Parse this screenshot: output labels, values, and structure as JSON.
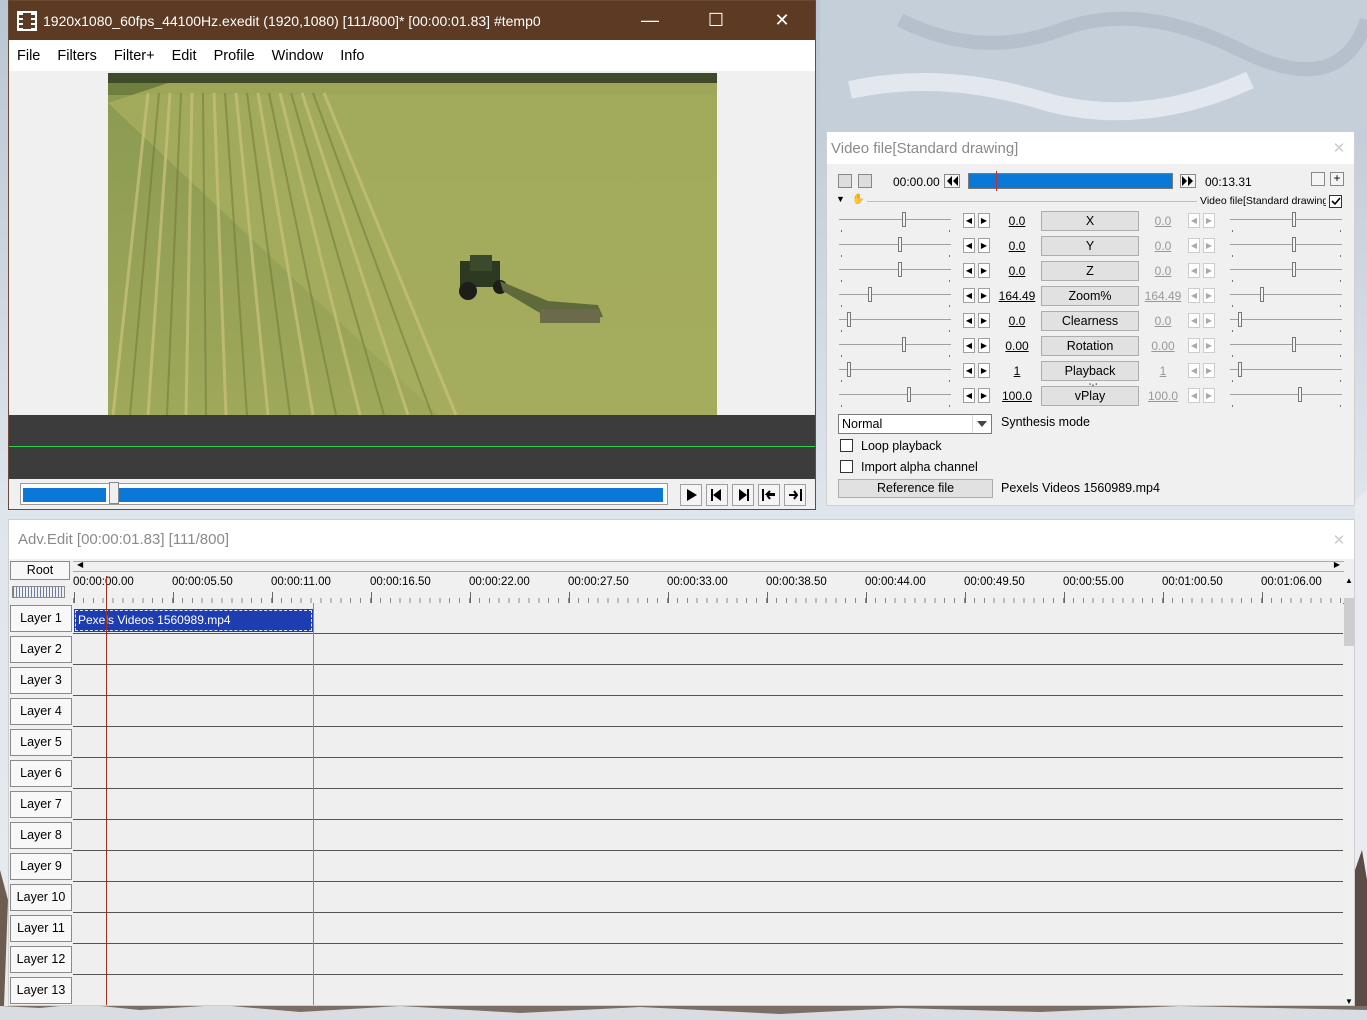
{
  "main_window": {
    "title": "1920x1080_60fps_44100Hz.exedit (1920,1080)  [111/800]* [00:00:01.83]  #temp0",
    "menu": [
      "File",
      "Filters",
      "Filter+",
      "Edit",
      "Profile",
      "Window",
      "Info"
    ],
    "seek_position": 0.14
  },
  "settings_window": {
    "title": "Video file[Standard drawing]",
    "time_start": "00:00.00",
    "time_end": "00:13.31",
    "section_label": "Video file[Standard drawing]",
    "section_enabled": true,
    "params": [
      {
        "left": "0.0",
        "label": "X",
        "right": "0.0"
      },
      {
        "left": "0.0",
        "label": "Y",
        "right": "0.0"
      },
      {
        "left": "0.0",
        "label": "Z",
        "right": "0.0"
      },
      {
        "left": "164.49",
        "label": "Zoom%",
        "right": "164.49"
      },
      {
        "left": "0.0",
        "label": "Clearness",
        "right": "0.0"
      },
      {
        "left": "0.00",
        "label": "Rotation",
        "right": "0.00"
      },
      {
        "left": "1",
        "label": "Playback position",
        "right": "1"
      },
      {
        "left": "100.0",
        "label": "vPlay",
        "right": "100.0"
      }
    ],
    "blend_mode": "Normal",
    "blend_label": "Synthesis mode",
    "loop_playback": "Loop playback",
    "import_alpha": "Import alpha channel",
    "reference_button": "Reference file",
    "reference_name": "Pexels Videos 1560989.mp4"
  },
  "timeline_window": {
    "title": "Adv.Edit [00:00:01.83] [111/800]",
    "root_label": "Root",
    "ruler_labels": [
      "00:00:00.00",
      "00:00:05.50",
      "00:00:11.00",
      "00:00:16.50",
      "00:00:22.00",
      "00:00:27.50",
      "00:00:33.00",
      "00:00:38.50",
      "00:00:44.00",
      "00:00:49.50",
      "00:00:55.00",
      "00:01:00.50",
      "00:01:06.00"
    ],
    "layers": [
      "Layer 1",
      "Layer 2",
      "Layer 3",
      "Layer 4",
      "Layer 5",
      "Layer 6",
      "Layer 7",
      "Layer 8",
      "Layer 9",
      "Layer 10",
      "Layer 11",
      "Layer 12",
      "Layer 13"
    ],
    "clip_label": "Pexels Videos 1560989.mp4"
  },
  "colors": {
    "title_bar": "#5c3a24",
    "selection_blue": "#0a78d7",
    "clip_blue": "#1d3db0",
    "cursor_line": "#a0301a"
  }
}
